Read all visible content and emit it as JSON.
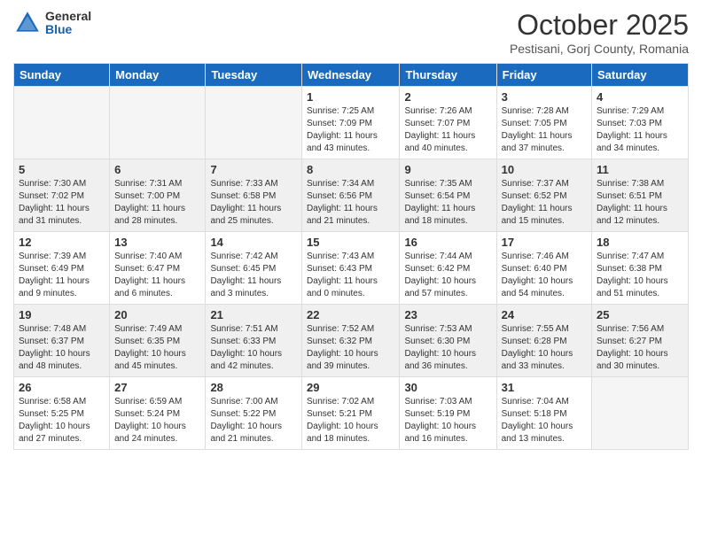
{
  "header": {
    "logo_general": "General",
    "logo_blue": "Blue",
    "month": "October 2025",
    "location": "Pestisani, Gorj County, Romania"
  },
  "days_of_week": [
    "Sunday",
    "Monday",
    "Tuesday",
    "Wednesday",
    "Thursday",
    "Friday",
    "Saturday"
  ],
  "weeks": [
    [
      {
        "day": "",
        "info": ""
      },
      {
        "day": "",
        "info": ""
      },
      {
        "day": "",
        "info": ""
      },
      {
        "day": "1",
        "info": "Sunrise: 7:25 AM\nSunset: 7:09 PM\nDaylight: 11 hours\nand 43 minutes."
      },
      {
        "day": "2",
        "info": "Sunrise: 7:26 AM\nSunset: 7:07 PM\nDaylight: 11 hours\nand 40 minutes."
      },
      {
        "day": "3",
        "info": "Sunrise: 7:28 AM\nSunset: 7:05 PM\nDaylight: 11 hours\nand 37 minutes."
      },
      {
        "day": "4",
        "info": "Sunrise: 7:29 AM\nSunset: 7:03 PM\nDaylight: 11 hours\nand 34 minutes."
      }
    ],
    [
      {
        "day": "5",
        "info": "Sunrise: 7:30 AM\nSunset: 7:02 PM\nDaylight: 11 hours\nand 31 minutes."
      },
      {
        "day": "6",
        "info": "Sunrise: 7:31 AM\nSunset: 7:00 PM\nDaylight: 11 hours\nand 28 minutes."
      },
      {
        "day": "7",
        "info": "Sunrise: 7:33 AM\nSunset: 6:58 PM\nDaylight: 11 hours\nand 25 minutes."
      },
      {
        "day": "8",
        "info": "Sunrise: 7:34 AM\nSunset: 6:56 PM\nDaylight: 11 hours\nand 21 minutes."
      },
      {
        "day": "9",
        "info": "Sunrise: 7:35 AM\nSunset: 6:54 PM\nDaylight: 11 hours\nand 18 minutes."
      },
      {
        "day": "10",
        "info": "Sunrise: 7:37 AM\nSunset: 6:52 PM\nDaylight: 11 hours\nand 15 minutes."
      },
      {
        "day": "11",
        "info": "Sunrise: 7:38 AM\nSunset: 6:51 PM\nDaylight: 11 hours\nand 12 minutes."
      }
    ],
    [
      {
        "day": "12",
        "info": "Sunrise: 7:39 AM\nSunset: 6:49 PM\nDaylight: 11 hours\nand 9 minutes."
      },
      {
        "day": "13",
        "info": "Sunrise: 7:40 AM\nSunset: 6:47 PM\nDaylight: 11 hours\nand 6 minutes."
      },
      {
        "day": "14",
        "info": "Sunrise: 7:42 AM\nSunset: 6:45 PM\nDaylight: 11 hours\nand 3 minutes."
      },
      {
        "day": "15",
        "info": "Sunrise: 7:43 AM\nSunset: 6:43 PM\nDaylight: 11 hours\nand 0 minutes."
      },
      {
        "day": "16",
        "info": "Sunrise: 7:44 AM\nSunset: 6:42 PM\nDaylight: 10 hours\nand 57 minutes."
      },
      {
        "day": "17",
        "info": "Sunrise: 7:46 AM\nSunset: 6:40 PM\nDaylight: 10 hours\nand 54 minutes."
      },
      {
        "day": "18",
        "info": "Sunrise: 7:47 AM\nSunset: 6:38 PM\nDaylight: 10 hours\nand 51 minutes."
      }
    ],
    [
      {
        "day": "19",
        "info": "Sunrise: 7:48 AM\nSunset: 6:37 PM\nDaylight: 10 hours\nand 48 minutes."
      },
      {
        "day": "20",
        "info": "Sunrise: 7:49 AM\nSunset: 6:35 PM\nDaylight: 10 hours\nand 45 minutes."
      },
      {
        "day": "21",
        "info": "Sunrise: 7:51 AM\nSunset: 6:33 PM\nDaylight: 10 hours\nand 42 minutes."
      },
      {
        "day": "22",
        "info": "Sunrise: 7:52 AM\nSunset: 6:32 PM\nDaylight: 10 hours\nand 39 minutes."
      },
      {
        "day": "23",
        "info": "Sunrise: 7:53 AM\nSunset: 6:30 PM\nDaylight: 10 hours\nand 36 minutes."
      },
      {
        "day": "24",
        "info": "Sunrise: 7:55 AM\nSunset: 6:28 PM\nDaylight: 10 hours\nand 33 minutes."
      },
      {
        "day": "25",
        "info": "Sunrise: 7:56 AM\nSunset: 6:27 PM\nDaylight: 10 hours\nand 30 minutes."
      }
    ],
    [
      {
        "day": "26",
        "info": "Sunrise: 6:58 AM\nSunset: 5:25 PM\nDaylight: 10 hours\nand 27 minutes."
      },
      {
        "day": "27",
        "info": "Sunrise: 6:59 AM\nSunset: 5:24 PM\nDaylight: 10 hours\nand 24 minutes."
      },
      {
        "day": "28",
        "info": "Sunrise: 7:00 AM\nSunset: 5:22 PM\nDaylight: 10 hours\nand 21 minutes."
      },
      {
        "day": "29",
        "info": "Sunrise: 7:02 AM\nSunset: 5:21 PM\nDaylight: 10 hours\nand 18 minutes."
      },
      {
        "day": "30",
        "info": "Sunrise: 7:03 AM\nSunset: 5:19 PM\nDaylight: 10 hours\nand 16 minutes."
      },
      {
        "day": "31",
        "info": "Sunrise: 7:04 AM\nSunset: 5:18 PM\nDaylight: 10 hours\nand 13 minutes."
      },
      {
        "day": "",
        "info": ""
      }
    ]
  ]
}
